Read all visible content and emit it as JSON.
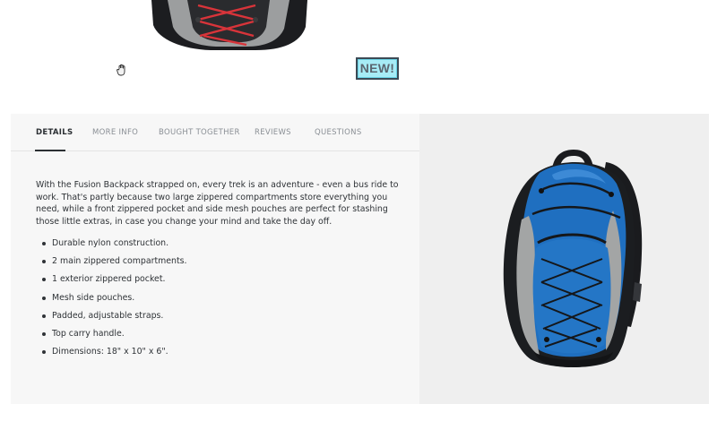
{
  "badge": {
    "label": "NEW!"
  },
  "tabs": [
    {
      "label": "DETAILS"
    },
    {
      "label": "MORE INFO"
    },
    {
      "label": "BOUGHT TOGETHER"
    },
    {
      "label": "REVIEWS"
    },
    {
      "label": "QUESTIONS"
    }
  ],
  "description": "With the Fusion Backpack strapped on, every trek is an adventure - even a bus ride to work. That's partly because two large zippered compartments store everything you need, while a front zippered pocket and side mesh pouches are perfect for stashing those little extras, in case you change your mind and take the day off.",
  "features": [
    "Durable nylon construction.",
    "2 main zippered compartments.",
    "1 exterior zippered pocket.",
    "Mesh side pouches.",
    "Padded, adjustable straps.",
    "Top carry handle.",
    "Dimensions: 18\" x 10\" x 6\"."
  ],
  "colors": {
    "backpack_blue": "#1f6fc0",
    "backpack_gray": "#a3a5a5",
    "backpack_black": "#1b1d20",
    "badge_bg": "#a7ecf6"
  }
}
